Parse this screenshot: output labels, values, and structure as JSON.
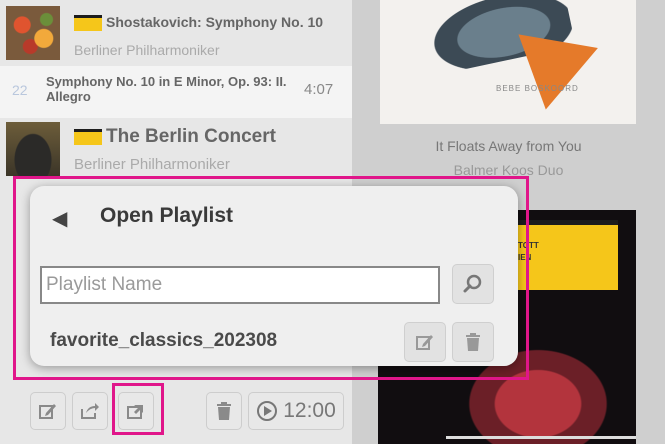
{
  "library": {
    "albums": [
      {
        "title": "Shostakovich: Symphony No. 10",
        "artist": "Berliner Philharmoniker"
      },
      {
        "title": "The Berlin Concert",
        "artist": "Berliner Philharmoniker"
      }
    ],
    "track": {
      "number": "22",
      "title": "Symphony No. 10 in E Minor, Op. 93: II. Allegro",
      "duration": "4:07"
    }
  },
  "right_panel": {
    "album_title": "It Floats Away from You",
    "album_artist": "Balmer Koos Duo",
    "fish_cover_caption": "BEBE BOSKOORD",
    "yellow_cover_line1": "TOTT",
    "yellow_cover_line2": "IEN"
  },
  "dialog": {
    "title": "Open Playlist",
    "input_placeholder": "Playlist Name",
    "input_value": "",
    "playlists": [
      "favorite_classics_202308"
    ]
  },
  "toolbar": {
    "timer_label": "12:00"
  },
  "icons": {
    "back": "arrow-left",
    "search": "magnifier",
    "edit": "pencil-square",
    "delete": "trash",
    "export": "share-arrow",
    "import": "import-arrow",
    "timer": "play-circle"
  },
  "colors": {
    "highlight": "#e0168a",
    "dg_yellow": "#f5c61a"
  }
}
